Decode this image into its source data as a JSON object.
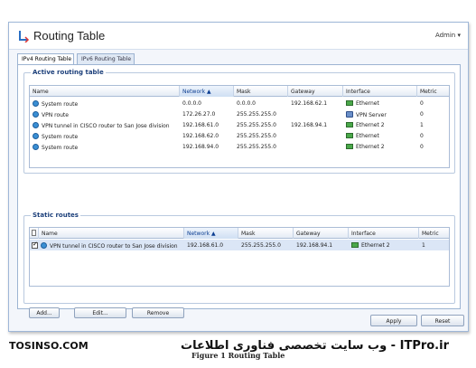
{
  "app": {
    "title": "Routing Table",
    "user": "Admin ▾"
  },
  "tabs": [
    {
      "label": "IPv4 Routing Table"
    },
    {
      "label": "IPv6 Routing Table"
    }
  ],
  "active_routes": {
    "title": "Active routing table",
    "columns": [
      "Name",
      "Network ▲",
      "Mask",
      "Gateway",
      "Interface",
      "Metric"
    ],
    "rows": [
      {
        "name": "System route",
        "network": "0.0.0.0",
        "mask": "0.0.0.0",
        "gateway": "192.168.62.1",
        "interface": "Ethernet",
        "metric": "0"
      },
      {
        "name": "VPN route",
        "network": "172.26.27.0",
        "mask": "255.255.255.0",
        "gateway": "",
        "interface": "VPN Server",
        "metric": "0"
      },
      {
        "name": "VPN tunnel in CISCO router to San Jose division",
        "network": "192.168.61.0",
        "mask": "255.255.255.0",
        "gateway": "192.168.94.1",
        "interface": "Ethernet 2",
        "metric": "1"
      },
      {
        "name": "System route",
        "network": "192.168.62.0",
        "mask": "255.255.255.0",
        "gateway": "",
        "interface": "Ethernet",
        "metric": "0"
      },
      {
        "name": "System route",
        "network": "192.168.94.0",
        "mask": "255.255.255.0",
        "gateway": "",
        "interface": "Ethernet 2",
        "metric": "0"
      }
    ]
  },
  "static_routes": {
    "title": "Static routes",
    "columns": [
      "Name",
      "Network ▲",
      "Mask",
      "Gateway",
      "Interface",
      "Metric"
    ],
    "rows": [
      {
        "name": "VPN tunnel in CISCO router to San Jose division",
        "network": "192.168.61.0",
        "mask": "255.255.255.0",
        "gateway": "192.168.94.1",
        "interface": "Ethernet 2",
        "metric": "1"
      }
    ],
    "buttons": {
      "add": "Add...",
      "edit": "Edit...",
      "remove": "Remove"
    }
  },
  "footer": {
    "apply": "Apply",
    "reset": "Reset"
  },
  "watermark": {
    "left": "TOSINSO.COM",
    "right": "ITPro.ir - وب سایت تخصصی فناوری اطلاعات"
  },
  "caption": "Figure 1 Routing Table",
  "colors": {
    "accent": "#1c3f7a",
    "selection": "#dbe6f6",
    "border": "#9db4d2"
  }
}
